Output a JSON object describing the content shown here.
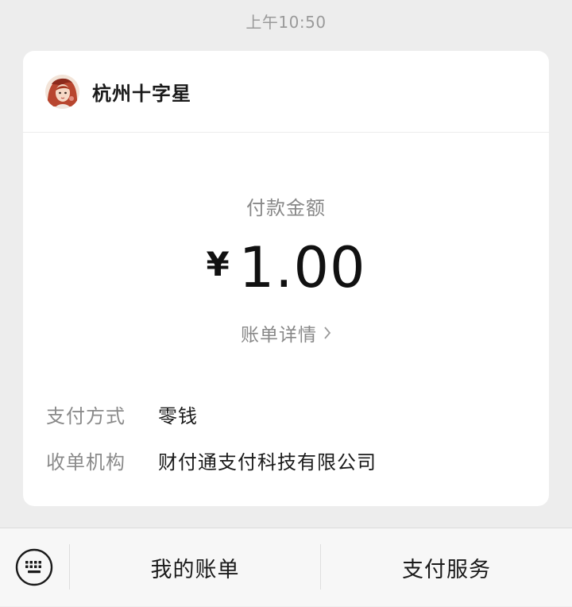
{
  "timestamp": "上午10:50",
  "merchant": {
    "name": "杭州十字星",
    "avatar_icon": "profile-avatar-icon"
  },
  "payment": {
    "amount_label": "付款金额",
    "currency_symbol": "¥",
    "amount": "1.00",
    "bill_detail_label": "账单详情",
    "bill_detail_icon": "chevron-right-icon"
  },
  "details": [
    {
      "label": "支付方式",
      "value": "零钱"
    },
    {
      "label": "收单机构",
      "value": "财付通支付科技有限公司"
    }
  ],
  "bottom_bar": {
    "keyboard_icon": "keyboard-icon",
    "my_bills_label": "我的账单",
    "pay_services_label": "支付服务"
  },
  "colors": {
    "background": "#ededed",
    "card": "#ffffff",
    "muted_text": "#888888",
    "primary_text": "#111111"
  }
}
